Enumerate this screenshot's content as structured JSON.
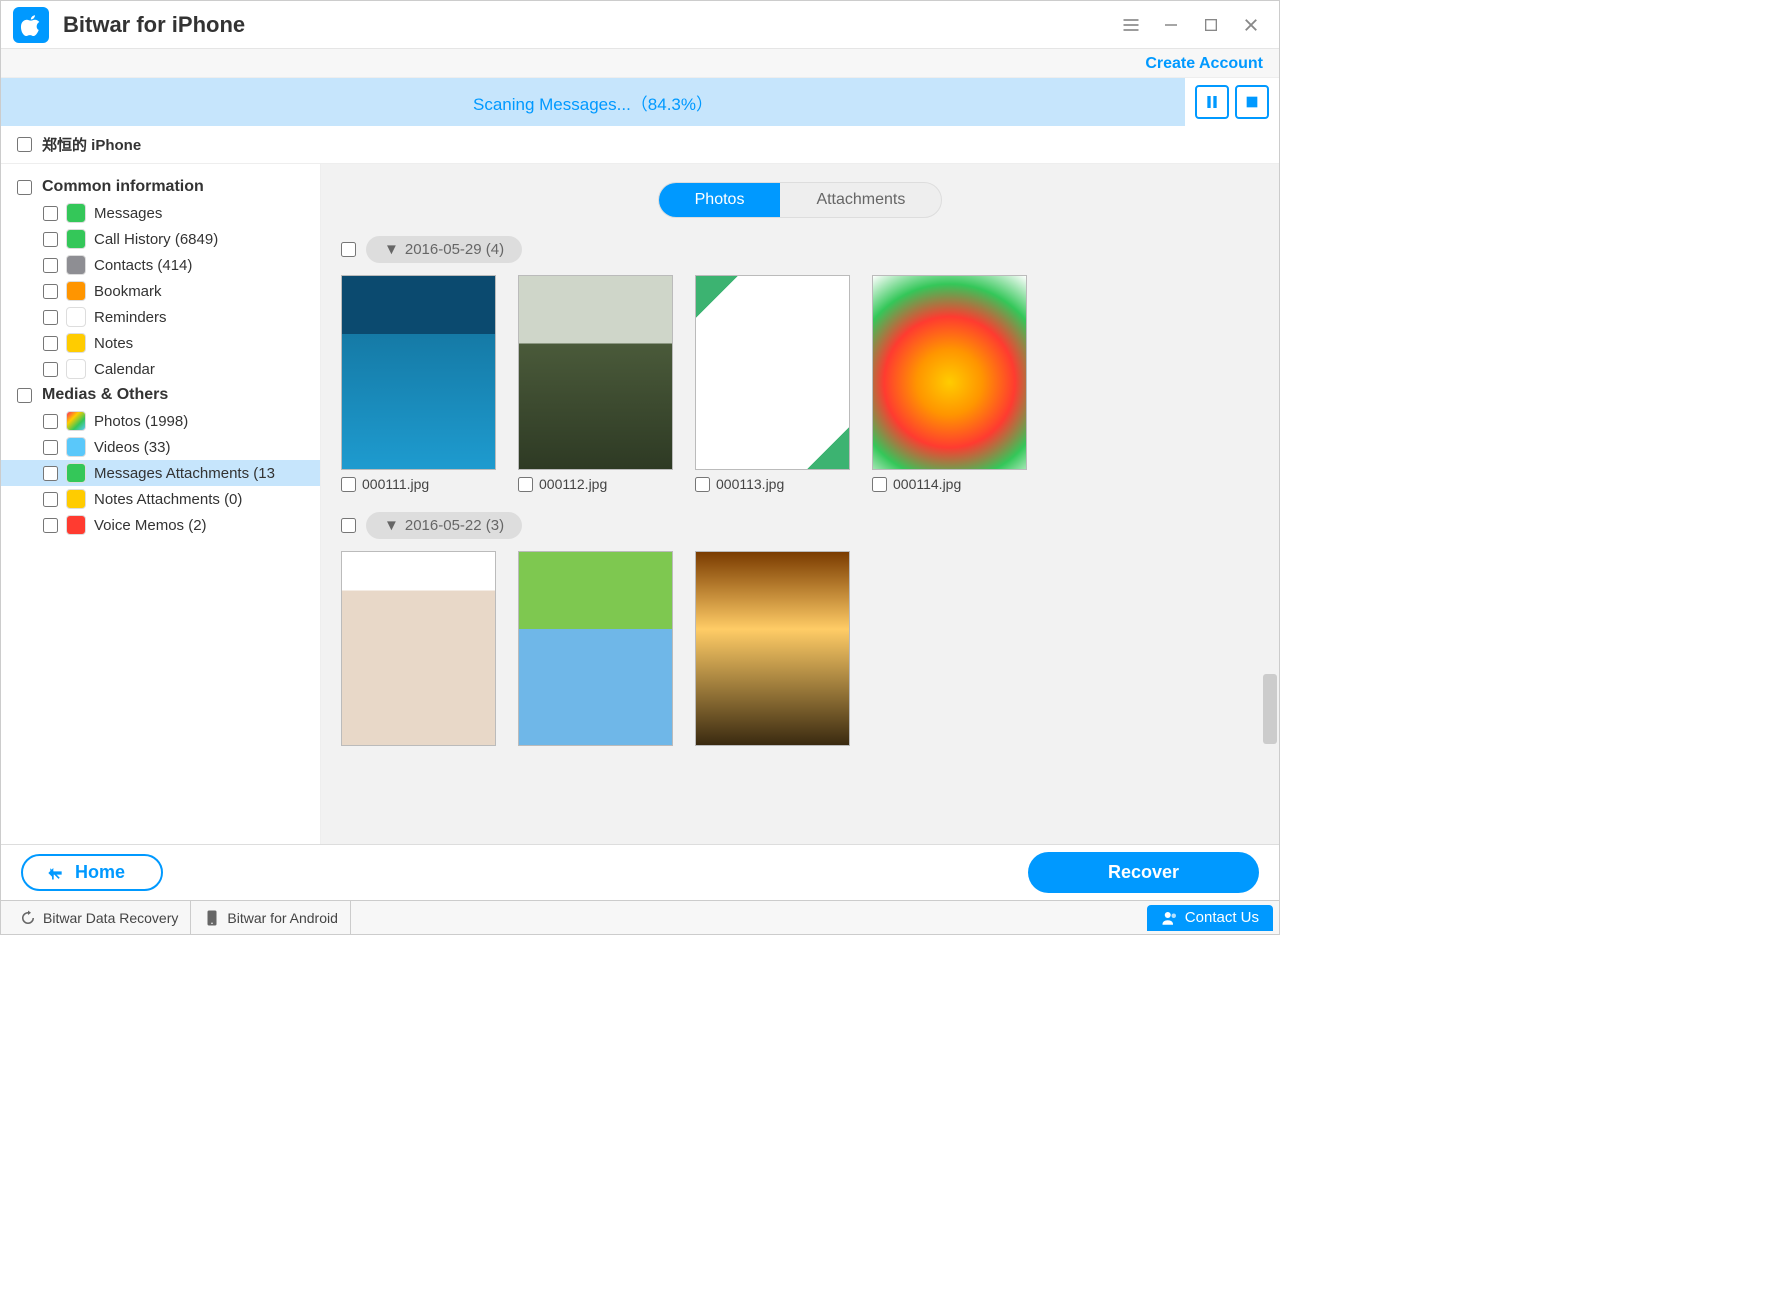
{
  "app": {
    "title": "Bitwar for iPhone"
  },
  "account": {
    "create_link": "Create Account"
  },
  "scan": {
    "status_text": "Scaning Messages...（84.3%）",
    "progress_percent": 84.3
  },
  "device": {
    "name": "郑恒的 iPhone"
  },
  "sidebar": {
    "sections": [
      {
        "title": "Common information",
        "items": [
          {
            "label": "Messages",
            "icon_bg": "#34c759",
            "selected": false
          },
          {
            "label": "Call History (6849)",
            "icon_bg": "#34c759",
            "selected": false
          },
          {
            "label": "Contacts (414)",
            "icon_bg": "#8e8e93",
            "selected": false
          },
          {
            "label": "Bookmark",
            "icon_bg": "#ff9500",
            "selected": false
          },
          {
            "label": "Reminders",
            "icon_bg": "#ffffff",
            "selected": false
          },
          {
            "label": "Notes",
            "icon_bg": "#ffcc00",
            "selected": false
          },
          {
            "label": "Calendar",
            "icon_bg": "#ffffff",
            "selected": false
          }
        ]
      },
      {
        "title": "Medias & Others",
        "items": [
          {
            "label": "Photos (1998)",
            "icon_bg": "linear-gradient(135deg,#ff2d55,#ffcc00,#34c759,#5ac8fa)",
            "selected": false
          },
          {
            "label": "Videos (33)",
            "icon_bg": "#5ac8fa",
            "selected": false
          },
          {
            "label": "Messages Attachments (13",
            "icon_bg": "#34c759",
            "selected": true
          },
          {
            "label": "Notes Attachments (0)",
            "icon_bg": "#ffcc00",
            "selected": false
          },
          {
            "label": "Voice Memos (2)",
            "icon_bg": "#ff3b30",
            "selected": false
          }
        ]
      }
    ]
  },
  "tabs": {
    "photos": "Photos",
    "attachments": "Attachments",
    "active": "photos"
  },
  "groups": [
    {
      "title": "2016-05-29 (4)",
      "items": [
        {
          "filename": "000111.jpg",
          "thumb_bg": "linear-gradient(#0b4a6f,#0b4a6f 30%,#157aa6 30%,#1e9bcf)"
        },
        {
          "filename": "000112.jpg",
          "thumb_bg": "linear-gradient(#cfd6c9,#cfd6c9 35%,#4a5a3a 35%,#2e3a24)"
        },
        {
          "filename": "000113.jpg",
          "thumb_bg": "linear-gradient(135deg,#3cb371 0 12%,#fff 12% 88%,#3cb371 88%)"
        },
        {
          "filename": "000114.jpg",
          "thumb_bg": "radial-gradient(circle at 50% 55%,#ffcc00,#ff9500,#ff3b30,#34c759,#fff)"
        }
      ]
    },
    {
      "title": "2016-05-22 (3)",
      "items": [
        {
          "filename": "",
          "thumb_bg": "linear-gradient(#fff,#fff 20%,#e8d8c8 20%,#e8d8c8)"
        },
        {
          "filename": "",
          "thumb_bg": "linear-gradient(#7ec850,#7ec850 40%,#6fb7e8 40%,#6fb7e8)"
        },
        {
          "filename": "",
          "thumb_bg": "linear-gradient(#7a3b00,#ffcc66 40%,#3a2a10)"
        }
      ]
    }
  ],
  "bottom": {
    "home": "Home",
    "recover": "Recover"
  },
  "footer": {
    "link1": "Bitwar Data Recovery",
    "link2": "Bitwar for Android",
    "contact": "Contact Us"
  }
}
